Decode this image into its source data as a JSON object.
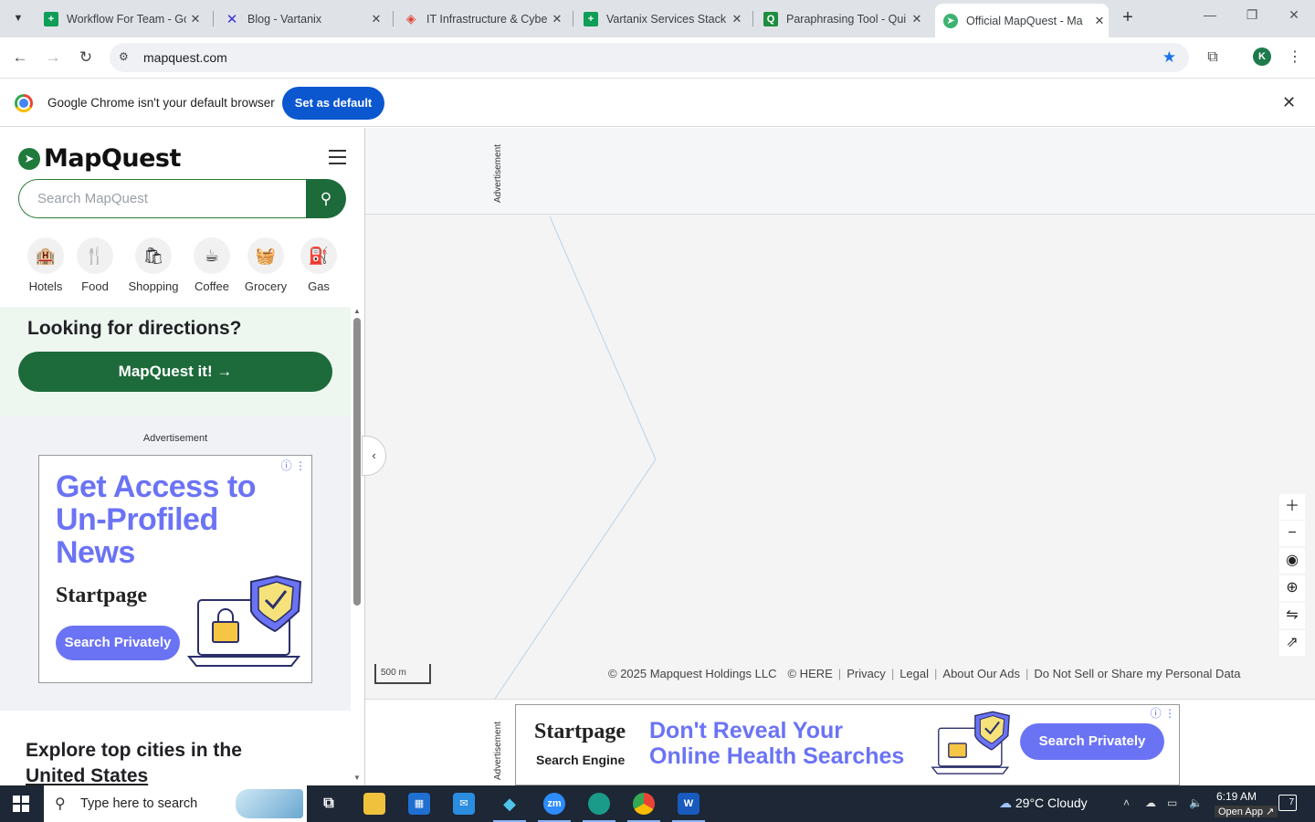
{
  "browser": {
    "tabs": [
      {
        "title": "Workflow For Team - Go",
        "icon": "sheets-icon",
        "color": "#0f9d58"
      },
      {
        "title": "Blog - Vartanix",
        "icon": "x-logo-icon",
        "color": "#3b32d6"
      },
      {
        "title": "IT Infrastructure & Cybe",
        "icon": "diamond-icon",
        "color": "#e0463a"
      },
      {
        "title": "Vartanix Services Stack",
        "icon": "sheets-icon",
        "color": "#0f9d58"
      },
      {
        "title": "Paraphrasing Tool - Qui",
        "icon": "quillbot-icon",
        "color": "#1e8e3e"
      },
      {
        "title": "Official MapQuest - Ma",
        "icon": "mapquest-icon",
        "color": "#3cb371"
      }
    ],
    "url": "mapquest.com",
    "profile_initial": "K",
    "infobar_text": "Google Chrome isn't your default browser",
    "set_default_label": "Set as default"
  },
  "mapquest": {
    "logo_text": "MapQuest",
    "search_placeholder": "Search MapQuest",
    "categories": [
      {
        "label": "Hotels",
        "icon": "hotel-icon"
      },
      {
        "label": "Food",
        "icon": "fork-knife-icon"
      },
      {
        "label": "Shopping",
        "icon": "shopping-bag-icon"
      },
      {
        "label": "Coffee",
        "icon": "coffee-cup-icon"
      },
      {
        "label": "Grocery",
        "icon": "grocery-basket-icon"
      },
      {
        "label": "Gas",
        "icon": "gas-pump-icon"
      }
    ],
    "directions_heading": "Looking for directions?",
    "directions_button": "MapQuest it!",
    "ad_label": "Advertisement",
    "side_ad": {
      "headline": "Get Access to Un-Profiled News",
      "brand": "Startpage",
      "button": "Search Privately"
    },
    "explore_line1": "Explore top cities in the",
    "explore_line2": "United States"
  },
  "map": {
    "top_ad_label": "Advertisement",
    "bottom_ad_label": "Advertisement",
    "scale": "500 m",
    "footer": {
      "copyright": "© 2025 Mapquest Holdings LLC",
      "here": "© HERE",
      "privacy": "Privacy",
      "legal": "Legal",
      "about_ads": "About Our Ads",
      "do_not_sell": "Do Not Sell or Share my Personal Data"
    },
    "bottom_ad": {
      "brand": "Startpage",
      "sub": "Search Engine",
      "headline_line1": "Don't Reveal Your",
      "headline_line2": "Online Health Searches",
      "button": "Search Privately"
    }
  },
  "taskbar": {
    "search_placeholder": "Type here to search",
    "weather": "29°C  Cloudy",
    "time": "6:19 AM",
    "open_app": "Open App ↗",
    "notifications": "7",
    "apps": [
      {
        "name": "task-view-icon"
      },
      {
        "name": "file-explorer-icon"
      },
      {
        "name": "microsoft-store-icon"
      },
      {
        "name": "mail-icon"
      },
      {
        "name": "kodi-icon"
      },
      {
        "name": "zoom-icon",
        "label": "zm"
      },
      {
        "name": "edge-icon"
      },
      {
        "name": "chrome-icon"
      },
      {
        "name": "word-icon",
        "label": "W"
      }
    ]
  }
}
